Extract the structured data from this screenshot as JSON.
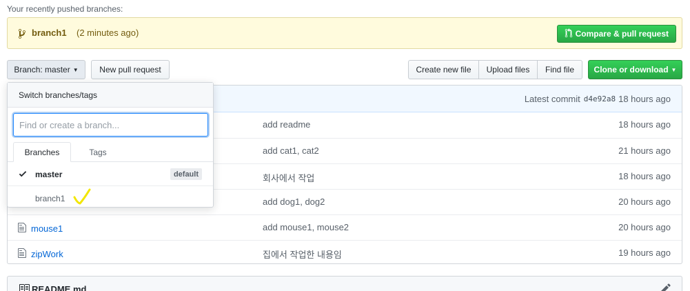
{
  "recent": {
    "title": "Your recently pushed branches:",
    "branch_name": "branch1",
    "branch_time": "(2 minutes ago)",
    "compare_label": "Compare & pull request"
  },
  "toolbar": {
    "branch_label": "Branch: master",
    "new_pr_label": "New pull request",
    "create_file_label": "Create new file",
    "upload_label": "Upload files",
    "find_file_label": "Find file",
    "clone_label": "Clone or download"
  },
  "commit": {
    "label": "Latest commit",
    "sha": "d4e92a8",
    "age": "18 hours ago"
  },
  "files": [
    {
      "name": "",
      "message": "add readme",
      "age": "18 hours ago",
      "icon": "file-icon"
    },
    {
      "name": "",
      "message": "add cat1, cat2",
      "age": "21 hours ago",
      "icon": "file-icon"
    },
    {
      "name": "",
      "message": "회사에서 작업",
      "age": "18 hours ago",
      "icon": "file-icon"
    },
    {
      "name": "",
      "message": "add dog1, dog2",
      "age": "20 hours ago",
      "icon": "file-icon"
    },
    {
      "name": "mouse1",
      "message": "add mouse1, mouse2",
      "age": "20 hours ago",
      "icon": "file-icon"
    },
    {
      "name": "zipWork",
      "message": "집에서 작업한 내용임",
      "age": "19 hours ago",
      "icon": "file-icon"
    }
  ],
  "readme": {
    "label": "README.md"
  },
  "dropdown": {
    "title": "Switch branches/tags",
    "filter_placeholder": "Find or create a branch...",
    "tabs": [
      "Branches",
      "Tags"
    ],
    "items": [
      {
        "name": "master",
        "badge": "default",
        "selected": true
      },
      {
        "name": "branch1",
        "badge": "",
        "selected": false
      }
    ]
  },
  "colors": {
    "green": "#28a745",
    "link_blue": "#0366d6",
    "banner_bg": "#fffbdd",
    "annotation_yellow": "#f2e600"
  }
}
